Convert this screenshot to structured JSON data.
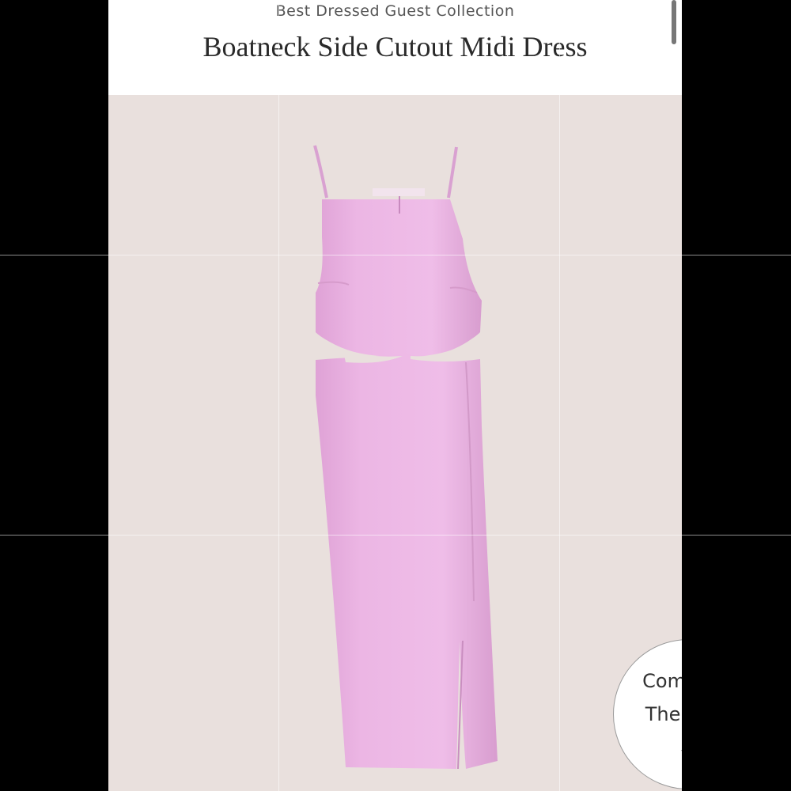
{
  "header": {
    "collection": "Best Dressed Guest Collection",
    "product_title": "Boatneck Side Cutout Midi Dress"
  },
  "product_image": {
    "subject": "dress-image",
    "dress_color": "#ecb6e4",
    "background_color": "#e9e0dd"
  },
  "complete_look": {
    "line1": "Complete",
    "line2": "The Look",
    "icon": "chevron-down-icon"
  }
}
